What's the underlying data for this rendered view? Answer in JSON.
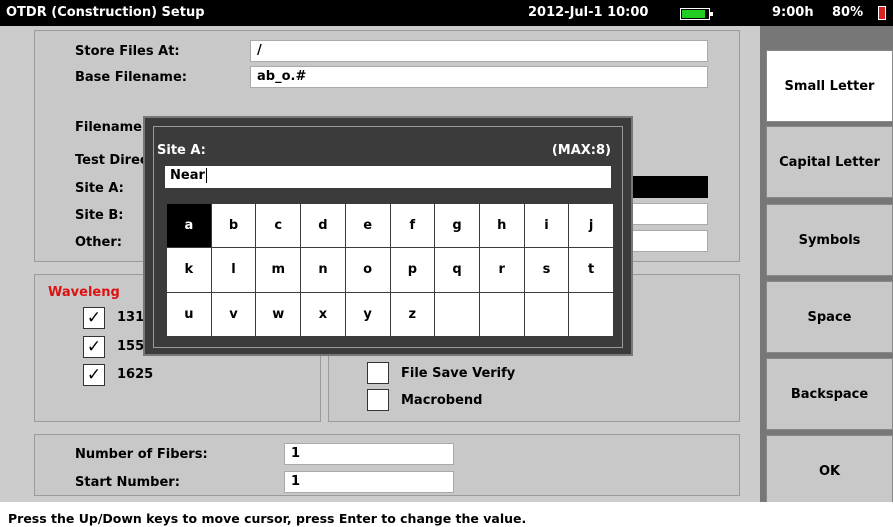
{
  "titlebar": {
    "title": "OTDR (Construction) Setup",
    "datetime": "2012-Jul-1 10:00",
    "battery_time": "9:00h",
    "battery_percent": "80%",
    "battery_color": "#22cc22"
  },
  "form": {
    "store_files_label": "Store Files At:",
    "store_files_value": "/",
    "base_filename_label": "Base Filename:",
    "base_filename_value": "ab_o.#",
    "filename_label": "Filename:",
    "test_direction_label": "Test Direc",
    "site_a_label": "Site A:",
    "site_b_label": "Site B:",
    "other_label": "Other:"
  },
  "wavelength": {
    "label": "Waveleng",
    "label_color": "#dd1111",
    "items": [
      {
        "label": "131",
        "checked": "✓"
      },
      {
        "label": "155",
        "checked": "✓"
      },
      {
        "label": "1625",
        "checked": "✓"
      }
    ]
  },
  "options": {
    "file_save_verify_label": "File Save Verify",
    "macrobend_label": "Macrobend"
  },
  "fibers": {
    "number_label": "Number of Fibers:",
    "number_value": "1",
    "start_label": "Start Number:",
    "start_value": "1"
  },
  "rail": {
    "small_letter": "Small Letter",
    "capital_letter": "Capital Letter",
    "symbols": "Symbols",
    "space": "Space",
    "backspace": "Backspace",
    "ok": "OK"
  },
  "status": {
    "text": "Press the Up/Down keys to move cursor, press Enter to change the value."
  },
  "dialog": {
    "title": "Site A:",
    "max": "(MAX:8)",
    "input_value": "Near",
    "keys": [
      "a",
      "b",
      "c",
      "d",
      "e",
      "f",
      "g",
      "h",
      "i",
      "j",
      "k",
      "l",
      "m",
      "n",
      "o",
      "p",
      "q",
      "r",
      "s",
      "t",
      "u",
      "v",
      "w",
      "x",
      "y",
      "z",
      "",
      "",
      "",
      ""
    ],
    "selected_key": "a"
  }
}
